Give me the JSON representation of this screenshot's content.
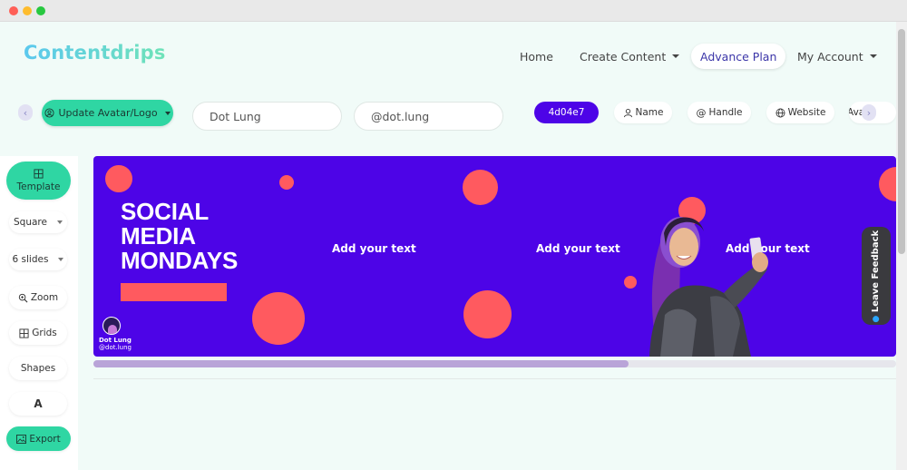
{
  "app": {
    "brand": "Contentdrips"
  },
  "nav": {
    "home": "Home",
    "create_content": "Create Content",
    "advance_plan": "Advance Plan",
    "my_account": "My Account"
  },
  "toolbar": {
    "avatar_button": "Update Avatar/Logo",
    "name_value": "Dot Lung",
    "handle_value": "@dot.lung",
    "color_hex": "4d04e7",
    "toggles": {
      "name": "Name",
      "handle": "Handle",
      "website": "Website",
      "avatar_partial": "Avata"
    }
  },
  "sidebar": {
    "template": "Template",
    "size": "Square",
    "slides": "6 slides",
    "zoom": "Zoom",
    "grids": "Grids",
    "shapes": "Shapes",
    "text_tool": "A",
    "export": "Export"
  },
  "canvas": {
    "headline_line1": "SOCIAL",
    "headline_line2": "MEDIA",
    "headline_line3": "MONDAYS",
    "slide2_text": "Add your text",
    "slide3_text": "Add your text",
    "slide4_text": "Add your text",
    "brand_name": "Dot Lung",
    "brand_handle": "@dot.lung"
  },
  "feedback": {
    "label": "Leave Feedback"
  },
  "colors": {
    "slide_bg": "#4d04e7",
    "accent_circle": "#ff5a5f",
    "primary_button": "#2fd6a3"
  }
}
